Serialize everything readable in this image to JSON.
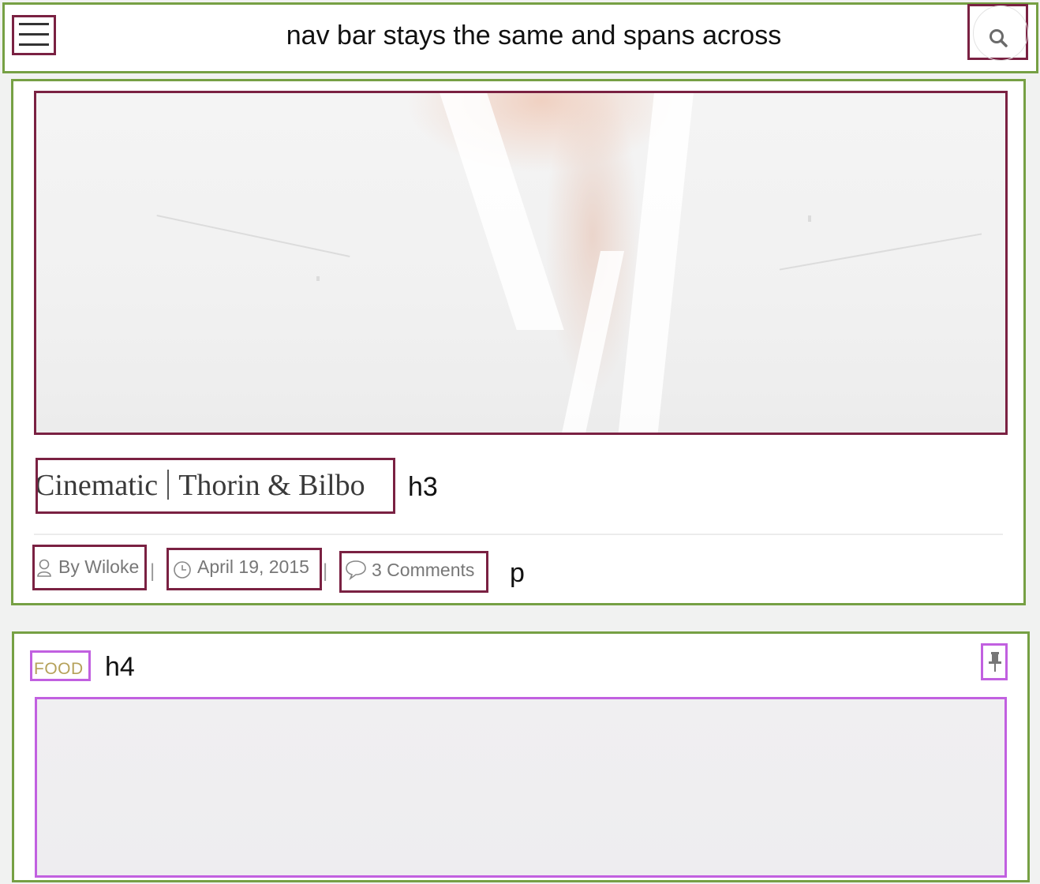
{
  "nav": {
    "title": "nav bar stays the same and spans across",
    "menu_icon": "hamburger-icon",
    "search_icon": "search-icon"
  },
  "post": {
    "title_left": "Cinematic",
    "title_right": "Thorin & Bilbo",
    "heading_tag": "h3",
    "author": "By Wiloke",
    "date": "April 19, 2015",
    "comments": "3 Comments",
    "separator": "|",
    "meta_tag": "p",
    "author_icon": "user-icon",
    "date_icon": "clock-icon",
    "comments_icon": "speech-bubble-icon"
  },
  "post2": {
    "category": "FOOD",
    "heading_tag": "h4",
    "pin_icon": "pin-icon"
  },
  "colors": {
    "region_outline": "#76a044",
    "element_outline": "#7a2142",
    "secondary_outline": "#c160e0",
    "category_text": "#b5a159"
  }
}
